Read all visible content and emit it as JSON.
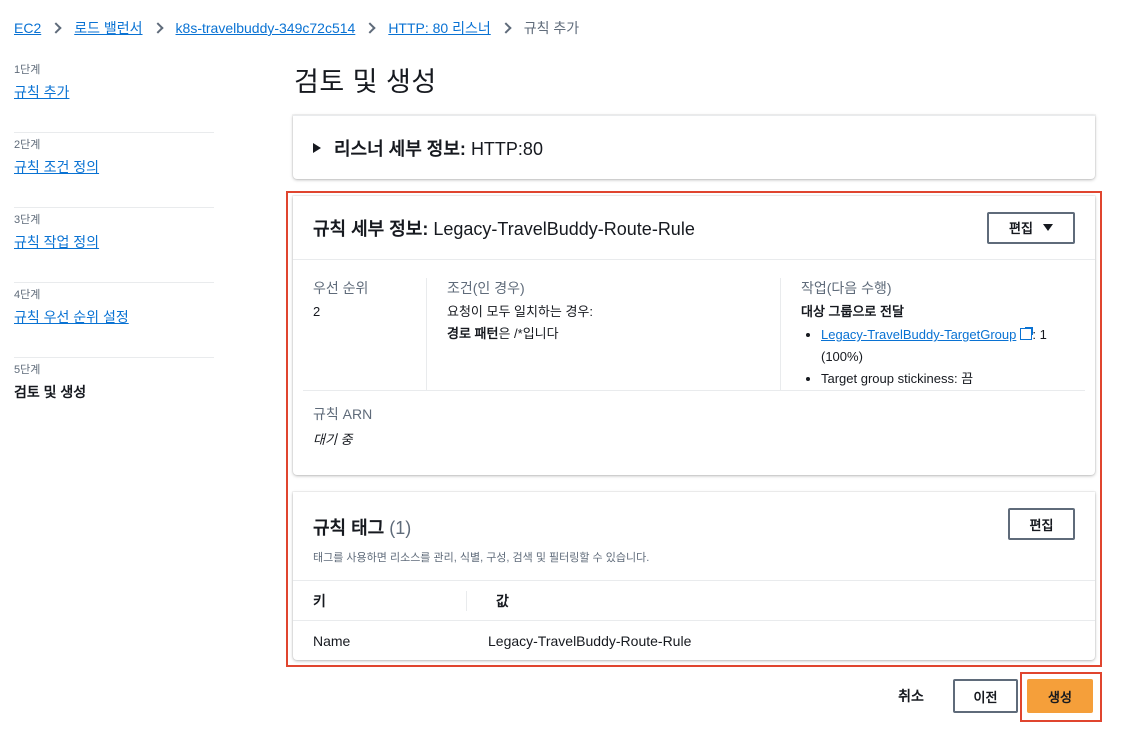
{
  "breadcrumb": {
    "items": [
      "EC2",
      "로드 밸런서",
      "k8s-travelbuddy-349c72c514",
      "HTTP: 80 리스너"
    ],
    "current": "규칙 추가"
  },
  "steps": [
    {
      "num": "1단계",
      "label": "규칙 추가"
    },
    {
      "num": "2단계",
      "label": "규칙 조건 정의"
    },
    {
      "num": "3단계",
      "label": "규칙 작업 정의"
    },
    {
      "num": "4단계",
      "label": "규칙 우선 순위 설정"
    },
    {
      "num": "5단계",
      "label": "검토 및 생성"
    }
  ],
  "page_title": "검토 및 생성",
  "listener": {
    "title": "리스너 세부 정보:",
    "value": "HTTP:80"
  },
  "rule_details": {
    "title": "규칙 세부 정보:",
    "name": "Legacy-TravelBuddy-Route-Rule",
    "edit_label": "편집",
    "priority_label": "우선 순위",
    "priority_value": "2",
    "condition_label": "조건(인 경우)",
    "condition_line1": "요청이 모두 일치하는 경우:",
    "condition_bold": "경로 패턴",
    "condition_rest": "은 /*입니다",
    "action_label": "작업(다음 수행)",
    "action_title": "대상 그룹으로 전달",
    "target_group_link": "Legacy-TravelBuddy-TargetGroup",
    "target_group_weight": ": 1",
    "target_group_percent": "(100%)",
    "stickiness": "Target group stickiness: 끔",
    "arn_label": "규칙 ARN",
    "arn_value": "대기 중"
  },
  "rule_tags": {
    "title": "규칙 태그",
    "count": "(1)",
    "description": "태그를 사용하면 리소스를 관리, 식별, 구성, 검색 및 필터링할 수 있습니다.",
    "edit_label": "편집",
    "columns": [
      "키",
      "값"
    ],
    "rows": [
      {
        "key": "Name",
        "value": "Legacy-TravelBuddy-Route-Rule"
      }
    ]
  },
  "footer": {
    "cancel_label": "취소",
    "previous_label": "이전",
    "create_label": "생성"
  },
  "colors": {
    "link": "#0972d3",
    "primary_button": "#f59f3a",
    "highlight": "#e0452f"
  }
}
